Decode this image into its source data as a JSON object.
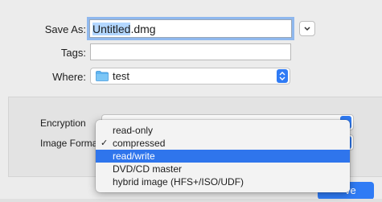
{
  "save_as": {
    "label": "Save As:",
    "value_selected": "Untitled",
    "value_rest": ".dmg"
  },
  "tags": {
    "label": "Tags:",
    "value": ""
  },
  "where": {
    "label": "Where:",
    "value": "test",
    "icon": "folder-icon"
  },
  "encryption": {
    "label": "Encryption"
  },
  "image_format": {
    "label": "Image Forma"
  },
  "format_menu": {
    "items": [
      {
        "label": "read-only",
        "checked": false,
        "highlighted": false
      },
      {
        "label": "compressed",
        "checked": true,
        "highlighted": false
      },
      {
        "label": "read/write",
        "checked": false,
        "highlighted": true
      },
      {
        "label": "DVD/CD master",
        "checked": false,
        "highlighted": false
      },
      {
        "label": "hybrid image (HFS+/ISO/UDF)",
        "checked": false,
        "highlighted": false
      }
    ],
    "check_glyph": "✓"
  },
  "save_button": {
    "label": "ve"
  },
  "colors": {
    "accent": "#2f75ec",
    "selection": "#b3d7ff",
    "folder": "#5fb4f0"
  }
}
